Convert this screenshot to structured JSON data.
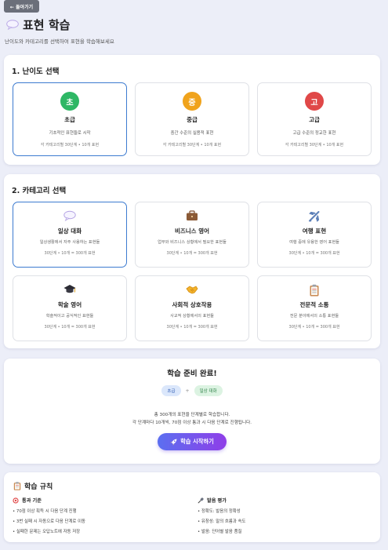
{
  "back_button": {
    "label": "← 돌아가기"
  },
  "header": {
    "title": "표현 학습",
    "subtitle": "난이도와 카테고리를 선택하여 표현을 학습해보세요"
  },
  "levels": {
    "title": "1. 난이도 선택",
    "items": [
      {
        "badge": "초",
        "name": "초급",
        "desc": "기초적인 표현들로 시작",
        "meta": "각 카테고리별 30단계 • 10개 표현",
        "color": "#2eb765",
        "selected": true
      },
      {
        "badge": "중",
        "name": "중급",
        "desc": "중간 수준의 실용적 표현",
        "meta": "각 카테고리별 30단계 • 10개 표현",
        "color": "#f0a31c",
        "selected": false
      },
      {
        "badge": "고",
        "name": "고급",
        "desc": "고급 수준의 정교한 표현",
        "meta": "각 카테고리별 30단계 • 10개 표현",
        "color": "#e04848",
        "selected": false
      }
    ]
  },
  "categories": {
    "title": "2. 카테고리 선택",
    "items": [
      {
        "icon": "speech-bubble-icon",
        "name": "일상 대화",
        "desc": "일상생활에서 자주 사용하는 표현들",
        "meta": "30단계 • 10개 = 300개 표현",
        "selected": true
      },
      {
        "icon": "briefcase-icon",
        "name": "비즈니스 영어",
        "desc": "업무와 비즈니스 상황에서 필요한 표현들",
        "meta": "30단계 • 10개 = 300개 표현",
        "selected": false
      },
      {
        "icon": "airplane-icon",
        "name": "여행 표현",
        "desc": "여행 중에 유용한 영어 표현들",
        "meta": "30단계 • 10개 = 300개 표현",
        "selected": false
      },
      {
        "icon": "graduation-cap-icon",
        "name": "학술 영어",
        "desc": "학술적이고 공식적인 표현들",
        "meta": "30단계 • 10개 = 300개 표현",
        "selected": false
      },
      {
        "icon": "handshake-icon",
        "name": "사회적 상호작용",
        "desc": "사교적 상황에서의 표현들",
        "meta": "30단계 • 10개 = 300개 표현",
        "selected": false
      },
      {
        "icon": "clipboard-icon",
        "name": "전문적 소통",
        "desc": "전문 분야에서의 소통 표현들",
        "meta": "30단계 • 10개 = 300개 표현",
        "selected": false
      }
    ]
  },
  "ready": {
    "title": "학습 준비 완료!",
    "tag_level": "초급",
    "tag_plus": "+",
    "tag_category": "일상 대화",
    "line1": "총 300개의 표현을 단계별로 학습합니다.",
    "line2": "각 단계마다 10개씩, 70점 이상 통과 시 다음 단계로 진행됩니다.",
    "start_label": "학습 시작하기"
  },
  "rules": {
    "title": "학습 규칙",
    "pass": {
      "title": "통과 기준",
      "items": [
        "• 70점 이상 획득 시 다음 단계 진행",
        "• 3번 실패 시 자동으로 다음 단계로 이동",
        "• 실패한 문제는 오답노트에 자동 저장"
      ]
    },
    "pronunciation": {
      "title": "발음 평가",
      "items": [
        "• 정확도: 발음의 정확성",
        "• 유창성: 말의 흐름과 속도",
        "• 발음: 단어별 발음 품질"
      ]
    }
  },
  "colors": {
    "selected_border": "#3d7bd0",
    "start_gradient": [
      "#5b6ff0",
      "#8f3ee8"
    ]
  }
}
